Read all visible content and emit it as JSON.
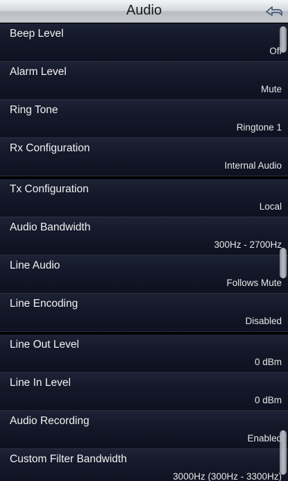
{
  "header": {
    "title": "Audio"
  },
  "groups": [
    {
      "items": [
        {
          "label": "Beep Level",
          "value": "Off"
        },
        {
          "label": "Alarm Level",
          "value": "Mute"
        },
        {
          "label": "Ring Tone",
          "value": "Ringtone 1"
        },
        {
          "label": "Rx Configuration",
          "value": "Internal Audio"
        }
      ]
    },
    {
      "items": [
        {
          "label": "Tx Configuration",
          "value": "Local"
        },
        {
          "label": "Audio Bandwidth",
          "value": "300Hz - 2700Hz"
        },
        {
          "label": "Line Audio",
          "value": "Follows Mute"
        },
        {
          "label": "Line Encoding",
          "value": "Disabled"
        }
      ]
    },
    {
      "items": [
        {
          "label": "Line Out Level",
          "value": "0 dBm"
        },
        {
          "label": "Line In Level",
          "value": "0 dBm"
        },
        {
          "label": "Audio Recording",
          "value": "Enabled"
        },
        {
          "label": "Custom Filter Bandwidth",
          "value": "3000Hz (300Hz - 3300Hz)"
        }
      ]
    }
  ],
  "icons": {
    "back": "back-arrow-icon"
  },
  "colors": {
    "row_bg": "#141829",
    "text": "#f2f2f2",
    "title_bar": "#d3d6da"
  }
}
